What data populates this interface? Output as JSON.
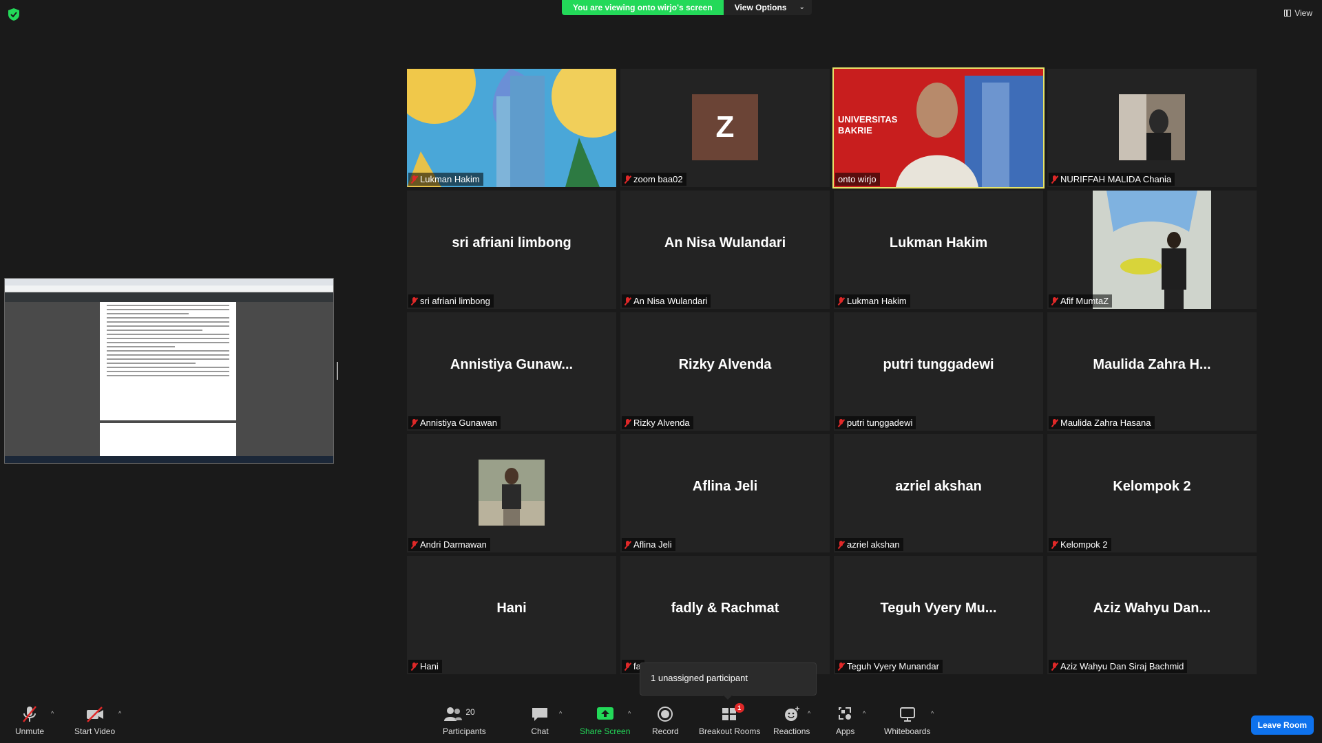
{
  "banner": {
    "sharing_text": "You are viewing onto wirjo's screen",
    "view_options": "View Options"
  },
  "view_label": "View",
  "tiles": [
    {
      "name": "Lukman Hakim",
      "display": "",
      "kind": "video"
    },
    {
      "name": "zoom baa02",
      "display": "Z",
      "kind": "avatar"
    },
    {
      "name": "onto wirjo",
      "display": "",
      "kind": "video",
      "active": true,
      "overlay": "UNIVERSITAS BAKRIE"
    },
    {
      "name": "NURIFFAH MALIDA Chania",
      "display": "",
      "kind": "photo"
    },
    {
      "name": "sri afriani limbong",
      "display": "sri afriani limbong",
      "kind": "name"
    },
    {
      "name": "An Nisa Wulandari",
      "display": "An Nisa Wulandari",
      "kind": "name"
    },
    {
      "name": "Lukman Hakim",
      "display": "Lukman Hakim",
      "kind": "name"
    },
    {
      "name": "Afif MumtaZ",
      "display": "",
      "kind": "photo"
    },
    {
      "name": "Annistiya Gunawan",
      "display": "Annistiya  Gunaw...",
      "kind": "name"
    },
    {
      "name": "Rizky Alvenda",
      "display": "Rizky Alvenda",
      "kind": "name"
    },
    {
      "name": "putri tunggadewi",
      "display": "putri tunggadewi",
      "kind": "name"
    },
    {
      "name": "Maulida Zahra Hasana",
      "display": "Maulida Zahra H...",
      "kind": "name"
    },
    {
      "name": "Andri Darmawan",
      "display": "",
      "kind": "photo"
    },
    {
      "name": "Aflina Jeli",
      "display": "Aflina Jeli",
      "kind": "name"
    },
    {
      "name": "azriel akshan",
      "display": "azriel akshan",
      "kind": "name"
    },
    {
      "name": "Kelompok 2",
      "display": "Kelompok 2",
      "kind": "name"
    },
    {
      "name": "Hani",
      "display": "Hani",
      "kind": "name"
    },
    {
      "name": "fa",
      "display": "fadly & Rachmat",
      "kind": "name"
    },
    {
      "name": "Teguh Vyery Munandar",
      "display": "Teguh Vyery Mu...",
      "kind": "name"
    },
    {
      "name": "Aziz Wahyu Dan Siraj Bachmid",
      "display": "Aziz Wahyu Dan...",
      "kind": "name"
    }
  ],
  "tooltip": "1 unassigned participant",
  "toolbar": {
    "unmute": "Unmute",
    "start_video": "Start Video",
    "participants": "Participants",
    "participants_count": "20",
    "chat": "Chat",
    "share_screen": "Share Screen",
    "record": "Record",
    "breakout_rooms": "Breakout Rooms",
    "breakout_badge": "1",
    "reactions": "Reactions",
    "apps": "Apps",
    "whiteboards": "Whiteboards",
    "leave": "Leave Room"
  },
  "colors": {
    "share_green": "#23d959",
    "active_border": "#e6e46a",
    "muted_red": "#e02828",
    "leave_blue": "#0e72ed"
  }
}
